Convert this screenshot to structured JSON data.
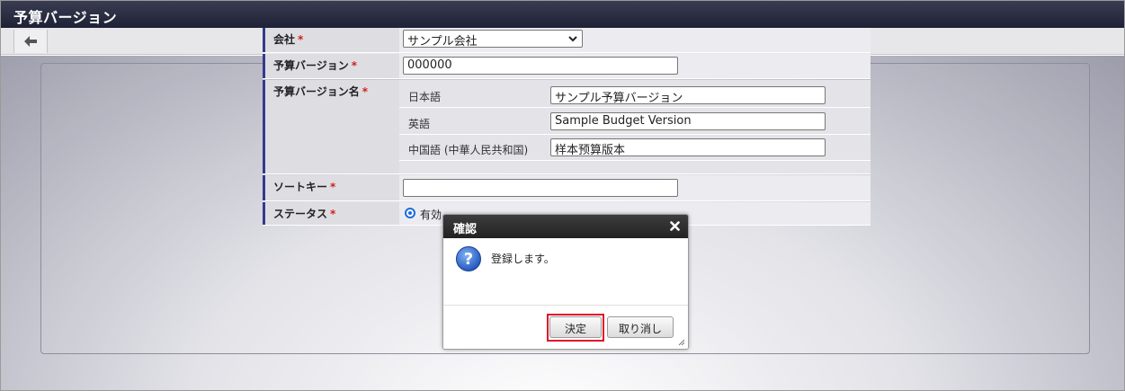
{
  "window": {
    "title": "予算バージョン"
  },
  "form": {
    "company": {
      "label": "会社",
      "required_mark": "*",
      "selected": "サンプル会社"
    },
    "budget_version": {
      "label": "予算バージョン",
      "required_mark": "*",
      "value": "000000"
    },
    "budget_version_name": {
      "label": "予算バージョン名",
      "required_mark": "*",
      "locales": [
        {
          "label": "日本語",
          "value": "サンプル予算バージョン"
        },
        {
          "label": "英語",
          "value": "Sample Budget Version"
        },
        {
          "label": "中国語 (中華人民共和国)",
          "value": "样本预算版本"
        }
      ]
    },
    "sort_key": {
      "label": "ソートキー",
      "required_mark": "*",
      "value": ""
    },
    "status": {
      "label": "ステータス",
      "required_mark": "*",
      "selected": "有効"
    }
  },
  "dialog": {
    "title": "確認",
    "message": "登録します。",
    "ok_label": "決定",
    "cancel_label": "取り消し",
    "icon": "question-icon"
  },
  "colors": {
    "accent": "#343a8c",
    "required": "#d02020",
    "highlight": "#e0142a"
  }
}
